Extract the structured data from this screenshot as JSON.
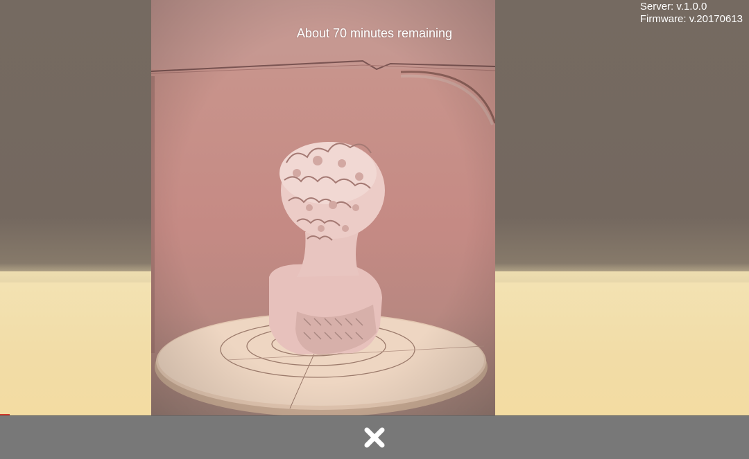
{
  "status": {
    "remaining": "About 70 minutes remaining"
  },
  "version": {
    "server": "Server: v.1.0.0",
    "firmware": "Firmware: v.20170613"
  },
  "preview": {
    "subject": "camera-preview-bust-sculpture"
  },
  "toolbar": {
    "close_icon": "close-icon"
  },
  "colors": {
    "bottom_bar": "#787878",
    "text": "#ffffff",
    "backdrop_top": "#756a61",
    "backdrop_bottom": "#f3dca2"
  }
}
